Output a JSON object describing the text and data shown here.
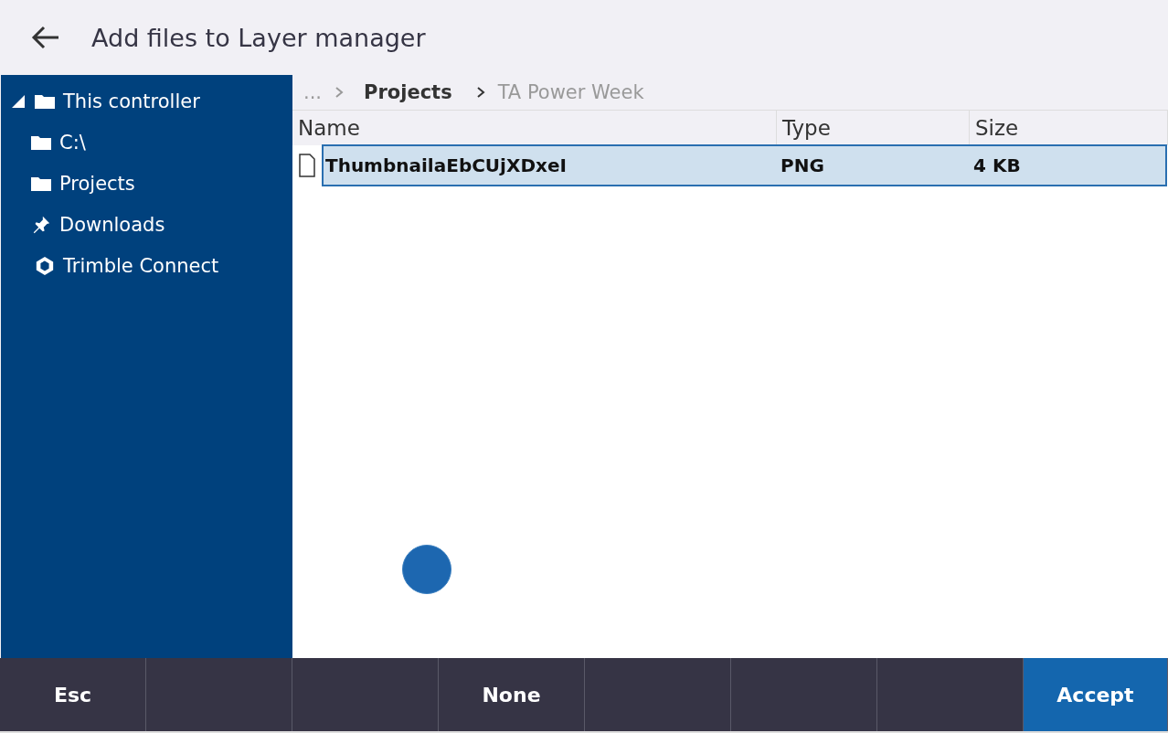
{
  "header": {
    "title": "Add files to Layer manager"
  },
  "sidebar": {
    "items": [
      {
        "label": "This controller",
        "kind": "folder",
        "expanded": true,
        "children": [
          {
            "label": "C:\\",
            "kind": "folder"
          },
          {
            "label": "Projects",
            "kind": "folder"
          },
          {
            "label": "Downloads",
            "kind": "pin"
          }
        ]
      },
      {
        "label": "Trimble Connect",
        "kind": "connect"
      }
    ]
  },
  "breadcrumb": [
    {
      "label": "...",
      "kind": "ellipsis"
    },
    {
      "label": "Projects",
      "kind": "parent"
    },
    {
      "label": "TA Power Week",
      "kind": "current"
    }
  ],
  "table": {
    "columns": [
      "Name",
      "Type",
      "Size"
    ],
    "rows": [
      {
        "cells": [
          "ThumbnailaEbCUjXDxeI",
          "PNG",
          "4 KB"
        ],
        "selected": true
      }
    ]
  },
  "softkeys": [
    {
      "label": "Esc",
      "kind": "normal"
    },
    {
      "kind": "normal"
    },
    {
      "kind": "normal"
    },
    {
      "label": "None",
      "kind": "normal"
    },
    {
      "kind": "normal"
    },
    {
      "kind": "normal"
    },
    {
      "kind": "normal"
    },
    {
      "label": "Accept",
      "kind": "primary"
    }
  ]
}
